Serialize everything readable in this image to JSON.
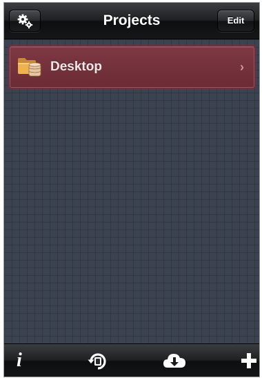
{
  "nav": {
    "title": "Projects",
    "edit_label": "Edit",
    "settings_icon": "gears-icon"
  },
  "projects": [
    {
      "label": "Desktop",
      "icon": "folder-database-icon",
      "accent": "#7a3640"
    }
  ],
  "toolbar": {
    "info_label": "i",
    "buttons": [
      "info-icon",
      "sync-icon",
      "cloud-download-icon",
      "plus-icon"
    ]
  },
  "colors": {
    "background": "#3c4350",
    "bar": "#1f2022",
    "row_accent": "#7a3640"
  }
}
